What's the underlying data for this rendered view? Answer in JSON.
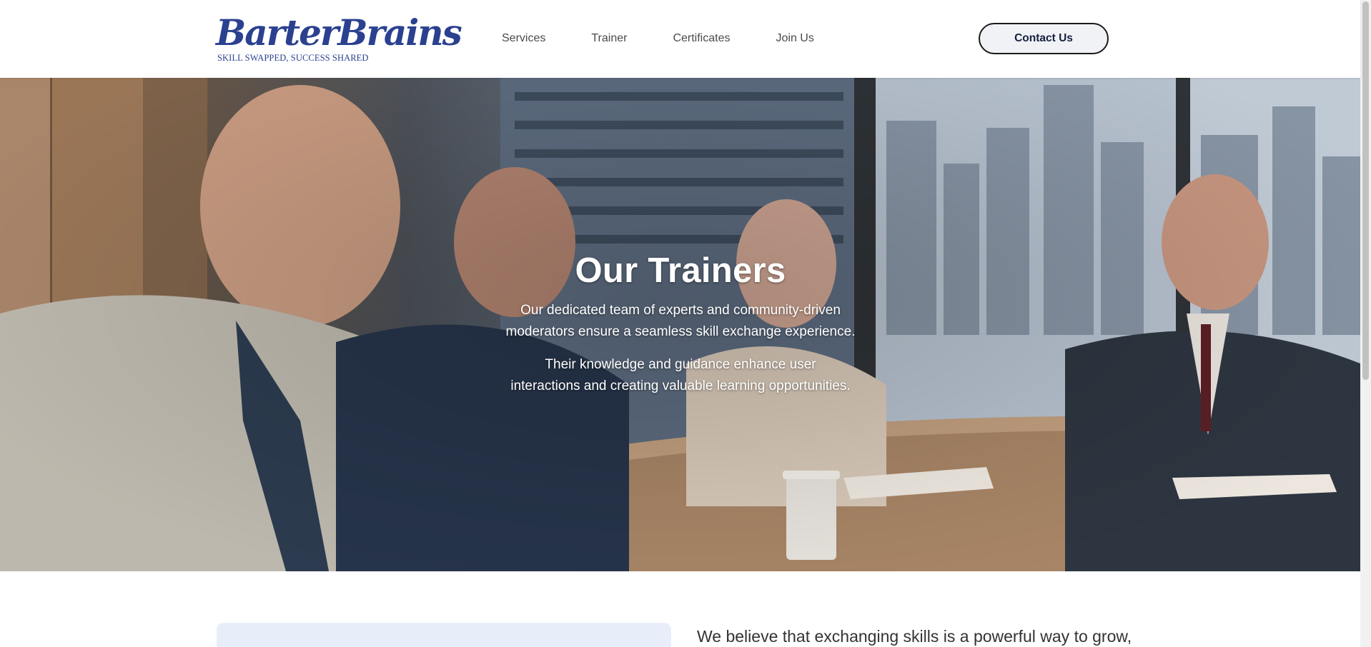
{
  "header": {
    "logo": {
      "wordmark": "BarterBrains",
      "tagline": "SKILL SWAPPED, SUCCESS SHARED"
    },
    "nav": [
      {
        "label": "Services"
      },
      {
        "label": "Trainer"
      },
      {
        "label": "Certificates"
      },
      {
        "label": "Join Us"
      }
    ],
    "contact_button": "Contact Us"
  },
  "hero": {
    "title": "Our Trainers",
    "paragraph_1": "Our dedicated team of experts and community-driven moderators ensure a seamless skill exchange experience.",
    "paragraph_1_lines": [
      "Our dedicated team of experts and community-driven",
      "moderators ensure a seamless skill exchange experience."
    ],
    "paragraph_2": "Their knowledge and guidance enhance user interactions and creating valuable learning opportunities.",
    "paragraph_2_lines": [
      "Their knowledge and guidance enhance user",
      "interactions and creating valuable learning opportunities."
    ],
    "background_image": "trainers-meeting-photo"
  },
  "section": {
    "intro_text": "We believe that exchanging skills is a powerful way to grow,"
  },
  "colors": {
    "brand": "#2b4190",
    "nav_text": "#4a4a4a",
    "button_bg": "#f1f2f6",
    "card_bg": "#e8eef9"
  }
}
